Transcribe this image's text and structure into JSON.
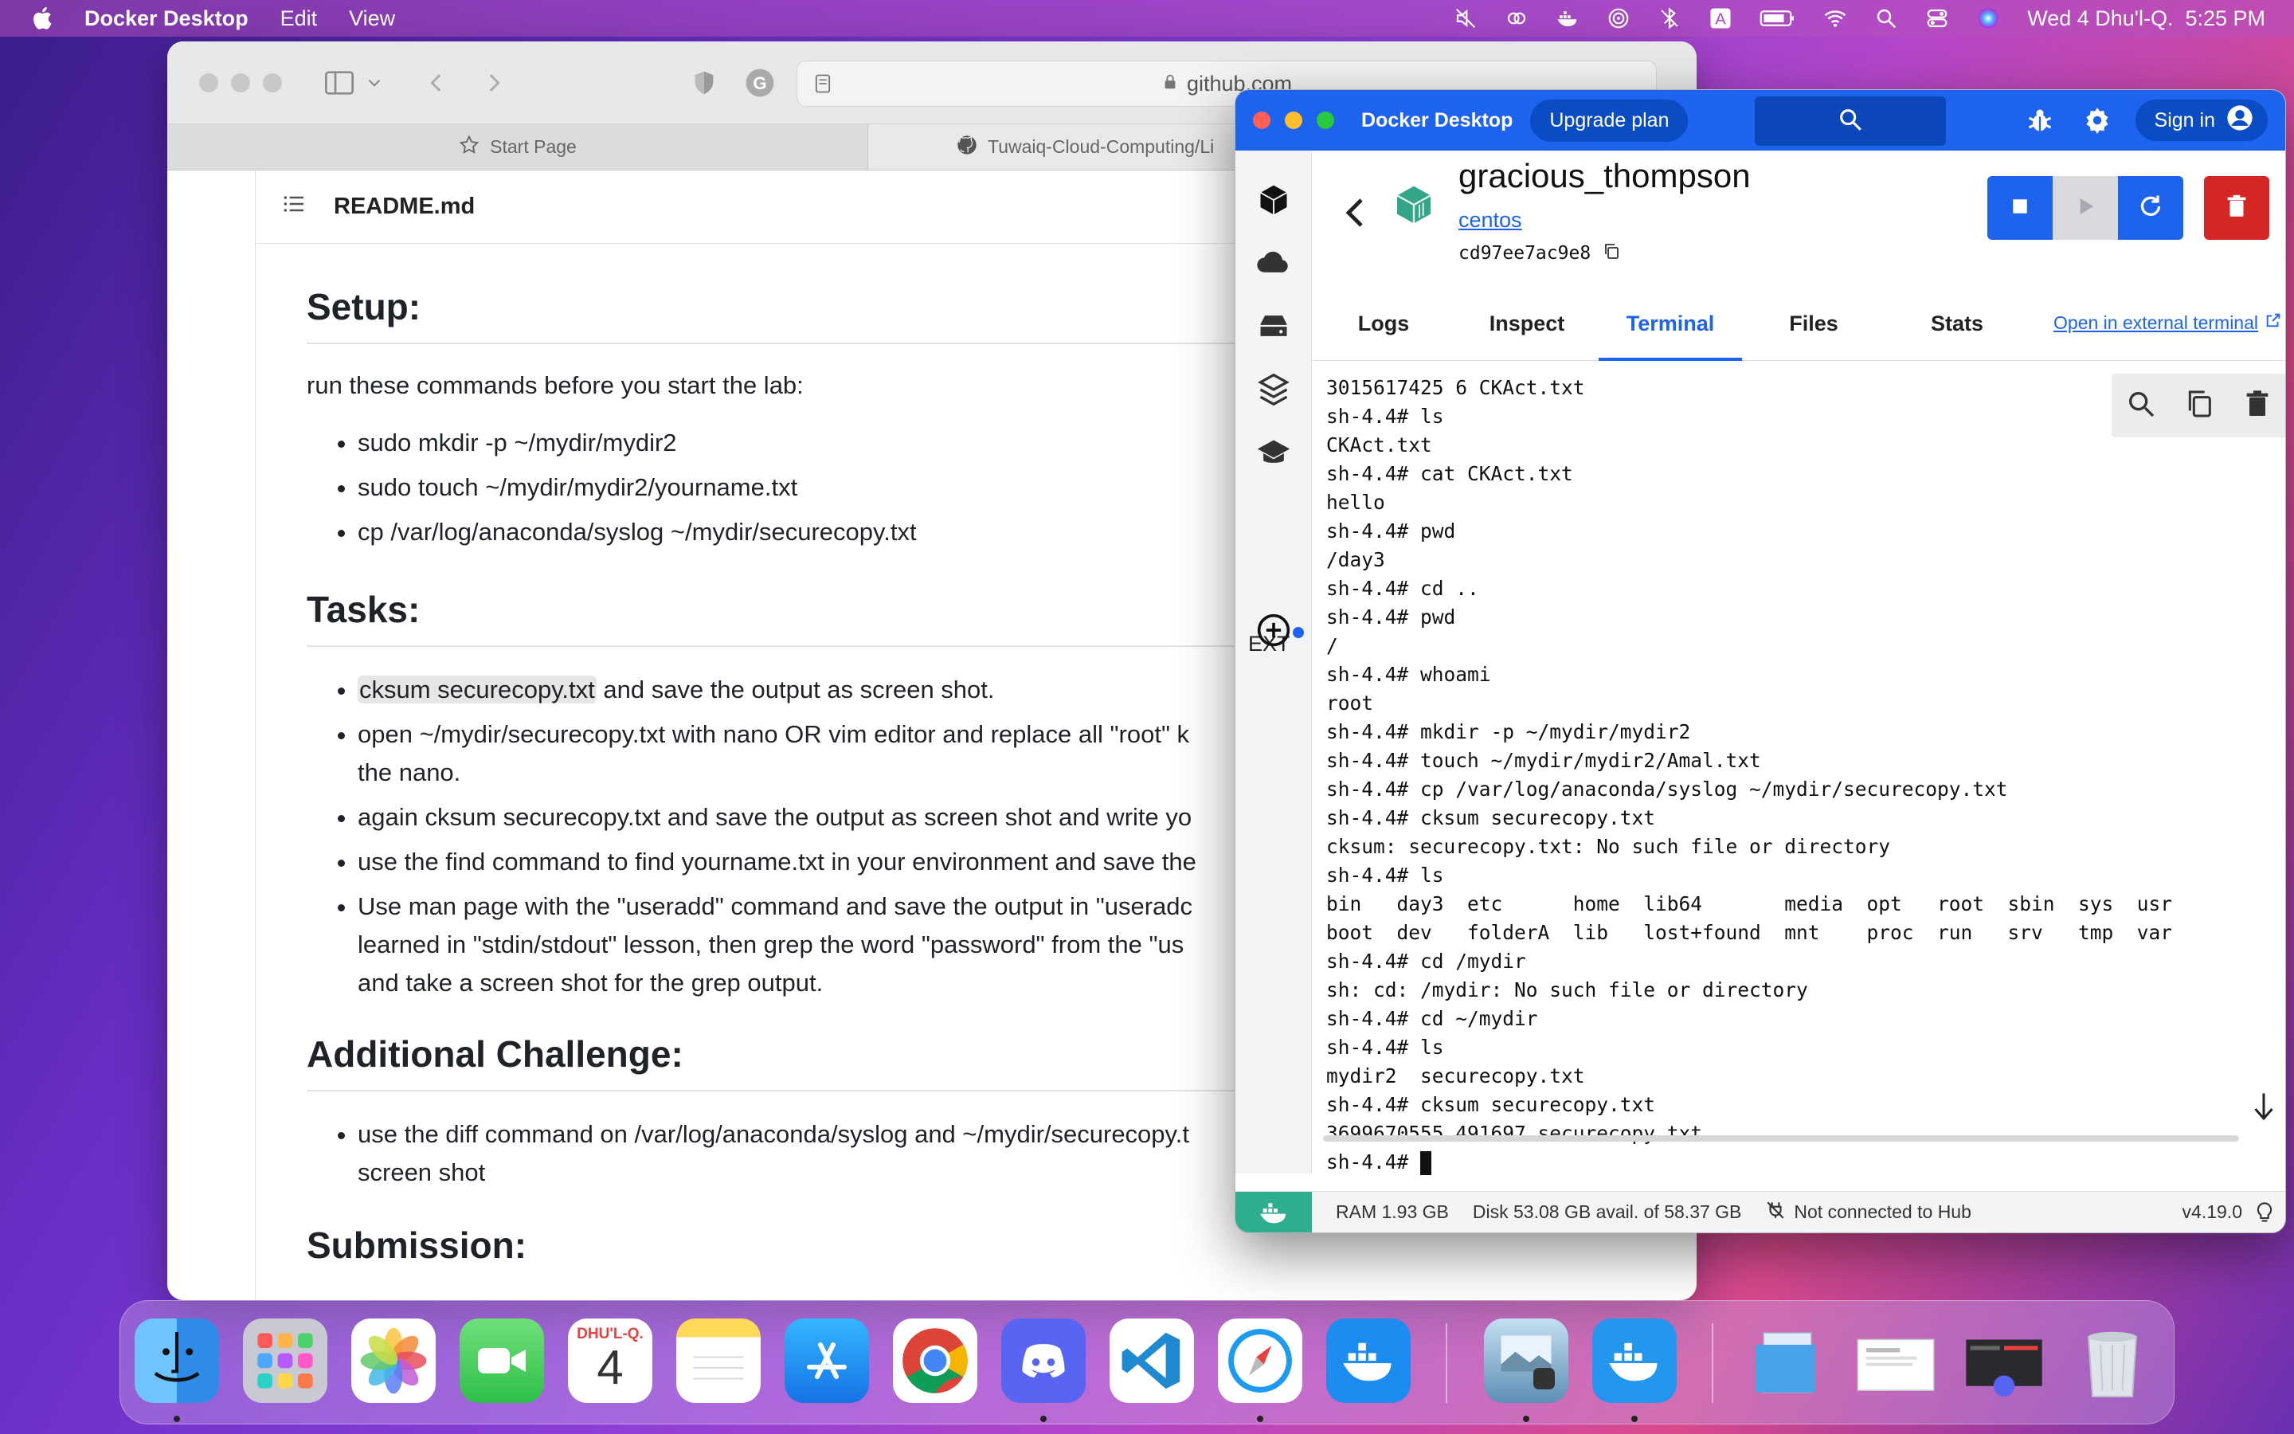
{
  "menubar": {
    "app_name": "Docker Desktop",
    "menus": [
      "Edit",
      "View"
    ],
    "datetime": "Wed 4 Dhu'l-Q.  5:25 PM",
    "icons": [
      "mute-icon",
      "link-icon",
      "docker-icon",
      "airdrop-icon",
      "bluetooth-off-icon",
      "keyboard-input-A-icon",
      "battery-icon",
      "wifi-icon",
      "search-icon",
      "control-center-icon",
      "siri-icon"
    ]
  },
  "safari": {
    "url": "github.com",
    "tabs": [
      {
        "label": "Start Page",
        "icon": "star-icon"
      },
      {
        "label": "Tuwaiq-Cloud-Computing/Li",
        "icon": "github-icon"
      }
    ],
    "file_name": "README.md",
    "setup_heading": "Setup:",
    "setup_intro": "run these commands before you start the lab:",
    "setup_items": [
      "sudo mkdir -p ~/mydir/mydir2",
      "sudo touch ~/mydir/mydir2/yourname.txt",
      "cp /var/log/anaconda/syslog ~/mydir/securecopy.txt"
    ],
    "tasks_heading": "Tasks:",
    "task1_code": "cksum securecopy.txt",
    "task1_rest": " and save the output as screen shot.",
    "task2a": "open ~/mydir/securecopy.txt with nano OR vim editor and replace all \"root\" k",
    "task2b": "the nano.",
    "task3": "again cksum securecopy.txt and save the output as screen shot and write yo",
    "task4": "use the find command to find yourname.txt in your environment and save the",
    "task5a": "Use man page with the \"useradd\" command and save the output in \"useradc",
    "task5b": "learned in \"stdin/stdout\" lesson, then grep the word \"password\" from the \"us",
    "task5c": "and take a screen shot for the grep output.",
    "challenge_heading": "Additional Challenge:",
    "challenge_a": "use the diff command on /var/log/anaconda/syslog and ~/mydir/securecopy.t",
    "challenge_b": "screen shot",
    "submission_heading": "Submission:"
  },
  "docker": {
    "title": "Docker Desktop",
    "upgrade_label": "Upgrade plan",
    "signin_label": "Sign in",
    "container_name": "gracious_thompson",
    "image_name": "centos",
    "container_id": "cd97ee7ac9e8",
    "tabs": [
      "Logs",
      "Inspect",
      "Terminal",
      "Files",
      "Stats"
    ],
    "active_tab": "Terminal",
    "external_terminal": "Open in external terminal",
    "sidebar_ext": "EXT",
    "accent": "#1d63ed",
    "danger": "#d52525",
    "terminal_lines": [
      "3015617425 6 CKAct.txt",
      "sh-4.4# ls",
      "CKAct.txt",
      "sh-4.4# cat CKAct.txt",
      "hello",
      "sh-4.4# pwd",
      "/day3",
      "sh-4.4# cd ..",
      "sh-4.4# pwd",
      "/",
      "sh-4.4# whoami",
      "root",
      "sh-4.4# mkdir -p ~/mydir/mydir2",
      "sh-4.4# touch ~/mydir/mydir2/Amal.txt",
      "sh-4.4# cp /var/log/anaconda/syslog ~/mydir/securecopy.txt",
      "sh-4.4# cksum securecopy.txt",
      "cksum: securecopy.txt: No such file or directory",
      "sh-4.4# ls",
      "bin   day3  etc      home  lib64       media  opt   root  sbin  sys  usr",
      "boot  dev   folderA  lib   lost+found  mnt    proc  run   srv   tmp  var",
      "sh-4.4# cd /mydir",
      "sh: cd: /mydir: No such file or directory",
      "sh-4.4# cd ~/mydir",
      "sh-4.4# ls",
      "mydir2  securecopy.txt",
      "sh-4.4# cksum securecopy.txt",
      "3699670555 491697 securecopy.txt"
    ],
    "prompt": "sh-4.4# ",
    "status": {
      "ram": "RAM 1.93 GB",
      "disk": "Disk 53.08 GB avail. of 58.37 GB",
      "hub": "Not connected to Hub",
      "version": "v4.19.0"
    }
  },
  "dock": {
    "apps": [
      "finder",
      "launchpad",
      "photos",
      "facetime",
      "calendar",
      "notes",
      "app-store",
      "chrome",
      "discord",
      "vscode",
      "safari",
      "docker",
      "preview",
      "docker-desktop"
    ],
    "calendar_month": "DHU'L-Q.",
    "calendar_day": "4"
  }
}
